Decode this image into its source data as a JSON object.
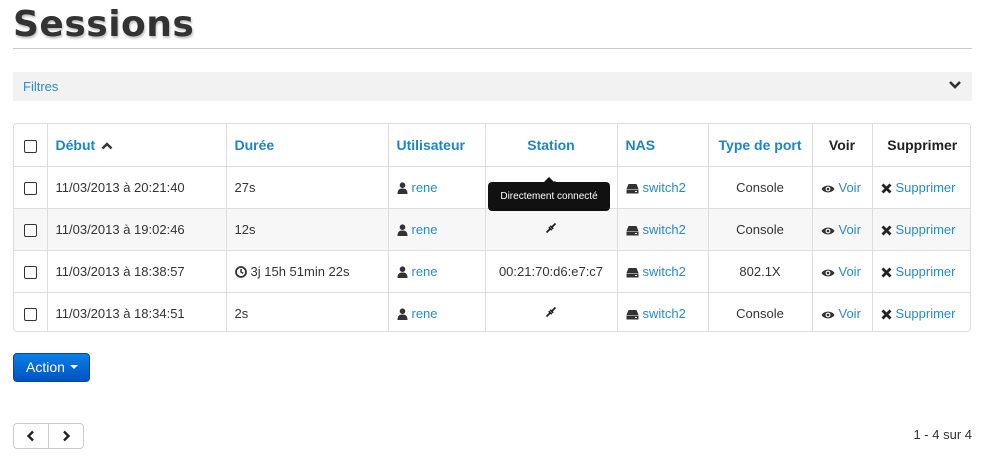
{
  "page": {
    "title": "Sessions"
  },
  "filters": {
    "label": "Filtres"
  },
  "table": {
    "columns": {
      "debut": "Début",
      "duree": "Durée",
      "utilisateur": "Utilisateur",
      "station": "Station",
      "nas": "NAS",
      "type_port": "Type de port",
      "voir": "Voir",
      "supprimer": "Supprimer"
    },
    "rows": [
      {
        "debut": "11/03/2013 à 20:21:40",
        "duree": "27s",
        "utilisateur": "rene",
        "station": "",
        "nas": "switch2",
        "type_port": "Console",
        "voir": "Voir",
        "supprimer": "Supprimer"
      },
      {
        "debut": "11/03/2013 à 19:02:46",
        "duree": "12s",
        "utilisateur": "rene",
        "station": "",
        "nas": "switch2",
        "type_port": "Console",
        "voir": "Voir",
        "supprimer": "Supprimer"
      },
      {
        "debut": "11/03/2013 à 18:38:57",
        "duree": "3j 15h 51min 22s",
        "utilisateur": "rene",
        "station": "00:21:70:d6:e7:c7",
        "nas": "switch2",
        "type_port": "802.1X",
        "voir": "Voir",
        "supprimer": "Supprimer"
      },
      {
        "debut": "11/03/2013 à 18:34:51",
        "duree": "2s",
        "utilisateur": "rene",
        "station": "",
        "nas": "switch2",
        "type_port": "Console",
        "voir": "Voir",
        "supprimer": "Supprimer"
      }
    ]
  },
  "tooltip": {
    "text": "Directement connecté"
  },
  "action_button": {
    "label": "Action"
  },
  "pagination": {
    "info": "1 - 4 sur 4"
  },
  "colors": {
    "link": "#2a8bc4",
    "button": "#0b6fd6"
  }
}
